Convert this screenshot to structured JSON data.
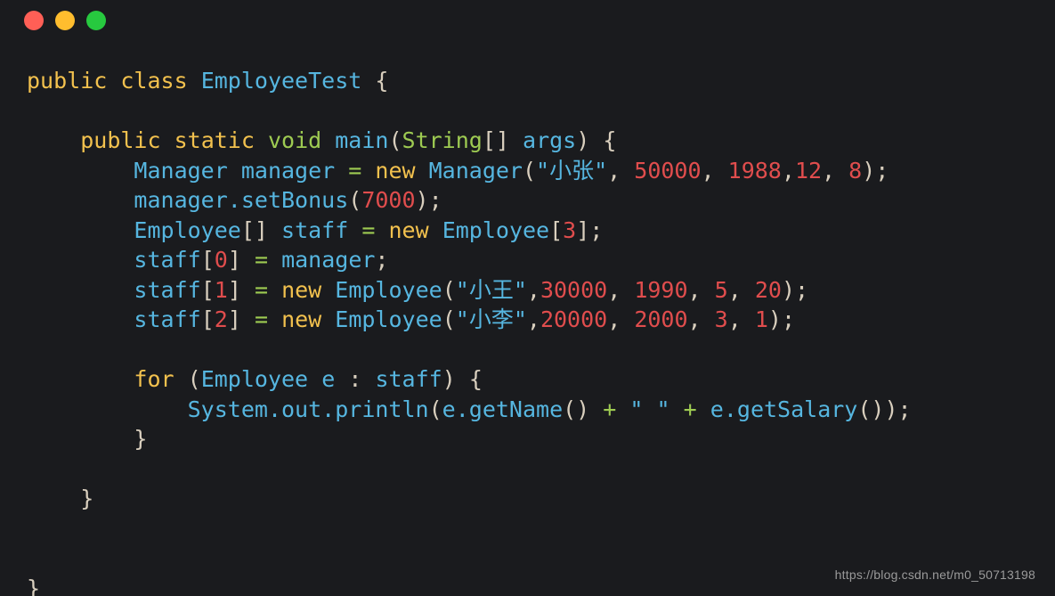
{
  "window": {
    "controls": [
      {
        "name": "close",
        "color": "#ff5f56"
      },
      {
        "name": "minimize",
        "color": "#ffbd2e"
      },
      {
        "name": "maximize",
        "color": "#27c93f"
      }
    ]
  },
  "theme": {
    "background": "#1a1b1e",
    "keyword": "#f2c14e",
    "type": "#56b6e0",
    "primitive": "#9ecb52",
    "identifier": "#56b6e0",
    "number": "#e04d4d",
    "string": "#56b6e0",
    "punctuation": "#d9cfbe",
    "operator": "#9ecb52",
    "watermark": "#9a9a9a"
  },
  "editor": {
    "language": "java",
    "filename": "EmployeeTest.java",
    "line_count": 18,
    "lines": [
      {
        "n": 1,
        "text": "public class EmployeeTest {",
        "tokens": [
          {
            "t": "public",
            "c": "t-kw"
          },
          {
            "t": " ",
            "c": "t-plain"
          },
          {
            "t": "class",
            "c": "t-kw"
          },
          {
            "t": " ",
            "c": "t-plain"
          },
          {
            "t": "EmployeeTest",
            "c": "t-type"
          },
          {
            "t": " ",
            "c": "t-plain"
          },
          {
            "t": "{",
            "c": "t-punc"
          }
        ]
      },
      {
        "n": 2,
        "text": "",
        "tokens": []
      },
      {
        "n": 3,
        "text": "    public static void main(String[] args) {",
        "tokens": [
          {
            "t": "    ",
            "c": "t-plain"
          },
          {
            "t": "public",
            "c": "t-kw"
          },
          {
            "t": " ",
            "c": "t-plain"
          },
          {
            "t": "static",
            "c": "t-kw"
          },
          {
            "t": " ",
            "c": "t-plain"
          },
          {
            "t": "void",
            "c": "t-prim"
          },
          {
            "t": " ",
            "c": "t-plain"
          },
          {
            "t": "main",
            "c": "t-ident"
          },
          {
            "t": "(",
            "c": "t-punc"
          },
          {
            "t": "String",
            "c": "t-prim"
          },
          {
            "t": "[]",
            "c": "t-punc"
          },
          {
            "t": " ",
            "c": "t-plain"
          },
          {
            "t": "args",
            "c": "t-ident"
          },
          {
            "t": ")",
            "c": "t-punc"
          },
          {
            "t": " ",
            "c": "t-plain"
          },
          {
            "t": "{",
            "c": "t-punc"
          }
        ]
      },
      {
        "n": 4,
        "text": "        Manager manager = new Manager(\"小张\", 50000, 1988,12, 8);",
        "tokens": [
          {
            "t": "        ",
            "c": "t-plain"
          },
          {
            "t": "Manager",
            "c": "t-type"
          },
          {
            "t": " ",
            "c": "t-plain"
          },
          {
            "t": "manager",
            "c": "t-ident"
          },
          {
            "t": " ",
            "c": "t-plain"
          },
          {
            "t": "=",
            "c": "t-op"
          },
          {
            "t": " ",
            "c": "t-plain"
          },
          {
            "t": "new",
            "c": "t-kw"
          },
          {
            "t": " ",
            "c": "t-plain"
          },
          {
            "t": "Manager",
            "c": "t-type"
          },
          {
            "t": "(",
            "c": "t-punc"
          },
          {
            "t": "\"小张\"",
            "c": "t-str"
          },
          {
            "t": ",",
            "c": "t-punc"
          },
          {
            "t": " ",
            "c": "t-plain"
          },
          {
            "t": "50000",
            "c": "t-num"
          },
          {
            "t": ",",
            "c": "t-punc"
          },
          {
            "t": " ",
            "c": "t-plain"
          },
          {
            "t": "1988",
            "c": "t-num"
          },
          {
            "t": ",",
            "c": "t-punc"
          },
          {
            "t": "12",
            "c": "t-num"
          },
          {
            "t": ",",
            "c": "t-punc"
          },
          {
            "t": " ",
            "c": "t-plain"
          },
          {
            "t": "8",
            "c": "t-num"
          },
          {
            "t": ")",
            "c": "t-punc"
          },
          {
            "t": ";",
            "c": "t-punc"
          }
        ]
      },
      {
        "n": 5,
        "text": "        manager.setBonus(7000);",
        "tokens": [
          {
            "t": "        ",
            "c": "t-plain"
          },
          {
            "t": "manager",
            "c": "t-ident"
          },
          {
            "t": ".",
            "c": "t-ident"
          },
          {
            "t": "setBonus",
            "c": "t-ident"
          },
          {
            "t": "(",
            "c": "t-punc"
          },
          {
            "t": "7000",
            "c": "t-num"
          },
          {
            "t": ")",
            "c": "t-punc"
          },
          {
            "t": ";",
            "c": "t-punc"
          }
        ]
      },
      {
        "n": 6,
        "text": "        Employee[] staff = new Employee[3];",
        "tokens": [
          {
            "t": "        ",
            "c": "t-plain"
          },
          {
            "t": "Employee",
            "c": "t-type"
          },
          {
            "t": "[]",
            "c": "t-punc"
          },
          {
            "t": " ",
            "c": "t-plain"
          },
          {
            "t": "staff",
            "c": "t-ident"
          },
          {
            "t": " ",
            "c": "t-plain"
          },
          {
            "t": "=",
            "c": "t-op"
          },
          {
            "t": " ",
            "c": "t-plain"
          },
          {
            "t": "new",
            "c": "t-kw"
          },
          {
            "t": " ",
            "c": "t-plain"
          },
          {
            "t": "Employee",
            "c": "t-type"
          },
          {
            "t": "[",
            "c": "t-punc"
          },
          {
            "t": "3",
            "c": "t-num"
          },
          {
            "t": "]",
            "c": "t-punc"
          },
          {
            "t": ";",
            "c": "t-punc"
          }
        ]
      },
      {
        "n": 7,
        "text": "        staff[0] = manager;",
        "tokens": [
          {
            "t": "        ",
            "c": "t-plain"
          },
          {
            "t": "staff",
            "c": "t-ident"
          },
          {
            "t": "[",
            "c": "t-punc"
          },
          {
            "t": "0",
            "c": "t-num"
          },
          {
            "t": "]",
            "c": "t-punc"
          },
          {
            "t": " ",
            "c": "t-plain"
          },
          {
            "t": "=",
            "c": "t-op"
          },
          {
            "t": " ",
            "c": "t-plain"
          },
          {
            "t": "manager",
            "c": "t-ident"
          },
          {
            "t": ";",
            "c": "t-punc"
          }
        ]
      },
      {
        "n": 8,
        "text": "        staff[1] = new Employee(\"小王\",30000, 1990, 5, 20);",
        "tokens": [
          {
            "t": "        ",
            "c": "t-plain"
          },
          {
            "t": "staff",
            "c": "t-ident"
          },
          {
            "t": "[",
            "c": "t-punc"
          },
          {
            "t": "1",
            "c": "t-num"
          },
          {
            "t": "]",
            "c": "t-punc"
          },
          {
            "t": " ",
            "c": "t-plain"
          },
          {
            "t": "=",
            "c": "t-op"
          },
          {
            "t": " ",
            "c": "t-plain"
          },
          {
            "t": "new",
            "c": "t-kw"
          },
          {
            "t": " ",
            "c": "t-plain"
          },
          {
            "t": "Employee",
            "c": "t-type"
          },
          {
            "t": "(",
            "c": "t-punc"
          },
          {
            "t": "\"小王\"",
            "c": "t-str"
          },
          {
            "t": ",",
            "c": "t-punc"
          },
          {
            "t": "30000",
            "c": "t-num"
          },
          {
            "t": ",",
            "c": "t-punc"
          },
          {
            "t": " ",
            "c": "t-plain"
          },
          {
            "t": "1990",
            "c": "t-num"
          },
          {
            "t": ",",
            "c": "t-punc"
          },
          {
            "t": " ",
            "c": "t-plain"
          },
          {
            "t": "5",
            "c": "t-num"
          },
          {
            "t": ",",
            "c": "t-punc"
          },
          {
            "t": " ",
            "c": "t-plain"
          },
          {
            "t": "20",
            "c": "t-num"
          },
          {
            "t": ")",
            "c": "t-punc"
          },
          {
            "t": ";",
            "c": "t-punc"
          }
        ]
      },
      {
        "n": 9,
        "text": "        staff[2] = new Employee(\"小李\",20000, 2000, 3, 1);",
        "tokens": [
          {
            "t": "        ",
            "c": "t-plain"
          },
          {
            "t": "staff",
            "c": "t-ident"
          },
          {
            "t": "[",
            "c": "t-punc"
          },
          {
            "t": "2",
            "c": "t-num"
          },
          {
            "t": "]",
            "c": "t-punc"
          },
          {
            "t": " ",
            "c": "t-plain"
          },
          {
            "t": "=",
            "c": "t-op"
          },
          {
            "t": " ",
            "c": "t-plain"
          },
          {
            "t": "new",
            "c": "t-kw"
          },
          {
            "t": " ",
            "c": "t-plain"
          },
          {
            "t": "Employee",
            "c": "t-type"
          },
          {
            "t": "(",
            "c": "t-punc"
          },
          {
            "t": "\"小李\"",
            "c": "t-str"
          },
          {
            "t": ",",
            "c": "t-punc"
          },
          {
            "t": "20000",
            "c": "t-num"
          },
          {
            "t": ",",
            "c": "t-punc"
          },
          {
            "t": " ",
            "c": "t-plain"
          },
          {
            "t": "2000",
            "c": "t-num"
          },
          {
            "t": ",",
            "c": "t-punc"
          },
          {
            "t": " ",
            "c": "t-plain"
          },
          {
            "t": "3",
            "c": "t-num"
          },
          {
            "t": ",",
            "c": "t-punc"
          },
          {
            "t": " ",
            "c": "t-plain"
          },
          {
            "t": "1",
            "c": "t-num"
          },
          {
            "t": ")",
            "c": "t-punc"
          },
          {
            "t": ";",
            "c": "t-punc"
          }
        ]
      },
      {
        "n": 10,
        "text": "",
        "tokens": []
      },
      {
        "n": 11,
        "text": "        for (Employee e : staff) {",
        "tokens": [
          {
            "t": "        ",
            "c": "t-plain"
          },
          {
            "t": "for",
            "c": "t-kw"
          },
          {
            "t": " ",
            "c": "t-plain"
          },
          {
            "t": "(",
            "c": "t-punc"
          },
          {
            "t": "Employee",
            "c": "t-type"
          },
          {
            "t": " ",
            "c": "t-plain"
          },
          {
            "t": "e",
            "c": "t-ident"
          },
          {
            "t": " ",
            "c": "t-plain"
          },
          {
            "t": ":",
            "c": "t-punc"
          },
          {
            "t": " ",
            "c": "t-plain"
          },
          {
            "t": "staff",
            "c": "t-ident"
          },
          {
            "t": ")",
            "c": "t-punc"
          },
          {
            "t": " ",
            "c": "t-plain"
          },
          {
            "t": "{",
            "c": "t-punc"
          }
        ]
      },
      {
        "n": 12,
        "text": "            System.out.println(e.getName() + \" \" + e.getSalary());",
        "tokens": [
          {
            "t": "            ",
            "c": "t-plain"
          },
          {
            "t": "System",
            "c": "t-ident"
          },
          {
            "t": ".",
            "c": "t-ident"
          },
          {
            "t": "out",
            "c": "t-ident"
          },
          {
            "t": ".",
            "c": "t-ident"
          },
          {
            "t": "println",
            "c": "t-ident"
          },
          {
            "t": "(",
            "c": "t-punc"
          },
          {
            "t": "e",
            "c": "t-ident"
          },
          {
            "t": ".",
            "c": "t-ident"
          },
          {
            "t": "getName",
            "c": "t-ident"
          },
          {
            "t": "()",
            "c": "t-punc"
          },
          {
            "t": " ",
            "c": "t-plain"
          },
          {
            "t": "+",
            "c": "t-op"
          },
          {
            "t": " ",
            "c": "t-plain"
          },
          {
            "t": "\" \"",
            "c": "t-str"
          },
          {
            "t": " ",
            "c": "t-plain"
          },
          {
            "t": "+",
            "c": "t-op"
          },
          {
            "t": " ",
            "c": "t-plain"
          },
          {
            "t": "e",
            "c": "t-ident"
          },
          {
            "t": ".",
            "c": "t-ident"
          },
          {
            "t": "getSalary",
            "c": "t-ident"
          },
          {
            "t": "())",
            "c": "t-punc"
          },
          {
            "t": ";",
            "c": "t-punc"
          }
        ]
      },
      {
        "n": 13,
        "text": "        }",
        "tokens": [
          {
            "t": "        ",
            "c": "t-plain"
          },
          {
            "t": "}",
            "c": "t-punc"
          }
        ]
      },
      {
        "n": 14,
        "text": "",
        "tokens": []
      },
      {
        "n": 15,
        "text": "    }",
        "tokens": [
          {
            "t": "    ",
            "c": "t-plain"
          },
          {
            "t": "}",
            "c": "t-punc"
          }
        ]
      },
      {
        "n": 16,
        "text": "",
        "tokens": []
      },
      {
        "n": 17,
        "text": "",
        "tokens": []
      },
      {
        "n": 18,
        "text": "}",
        "tokens": [
          {
            "t": "}",
            "c": "t-punc"
          }
        ]
      }
    ]
  },
  "watermark": {
    "text": "https://blog.csdn.net/m0_50713198"
  }
}
